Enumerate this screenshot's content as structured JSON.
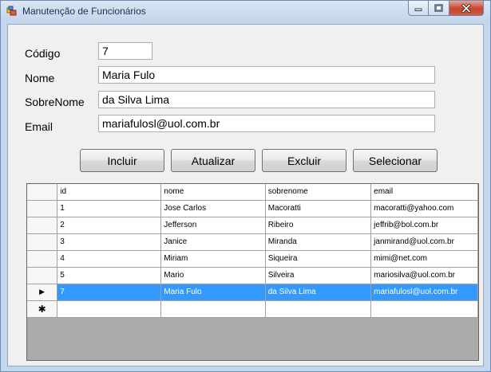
{
  "window": {
    "title": "Manutenção de Funcionários",
    "close_color": "#c7432d"
  },
  "form": {
    "codigo_label": "Código",
    "codigo_value": "7",
    "nome_label": "Nome",
    "nome_value": "Maria Fulo",
    "sobrenome_label": "SobreNome",
    "sobrenome_value": "da Silva Lima",
    "email_label": "Email",
    "email_value": "mariafulosl@uol.com.br"
  },
  "buttons": {
    "incluir": "Incluir",
    "atualizar": "Atualizar",
    "excluir": "Excluir",
    "selecionar": "Selecionar"
  },
  "grid": {
    "columns": [
      "id",
      "nome",
      "sobrenome",
      "email"
    ],
    "rows": [
      [
        "1",
        "Jose Carlos",
        "Macoratti",
        "macoratti@yahoo.com"
      ],
      [
        "2",
        "Jefferson",
        "Ribeiro",
        "jeffrib@bol.com.br"
      ],
      [
        "3",
        "Janice",
        "Miranda",
        "janmirand@uol.com.br"
      ],
      [
        "4",
        "Miriam",
        "Siqueira",
        "mimi@net.com"
      ],
      [
        "5",
        "Mario",
        "Silveira",
        "mariosilva@uol.com.br"
      ],
      [
        "7",
        "Maria Fulo",
        "da Silva Lima",
        "mariafulosl@uol.com.br"
      ]
    ],
    "selected_row_index": 5,
    "selection_color": "#3399ff",
    "current_row_marker": "▶",
    "new_row_marker": "✱"
  }
}
